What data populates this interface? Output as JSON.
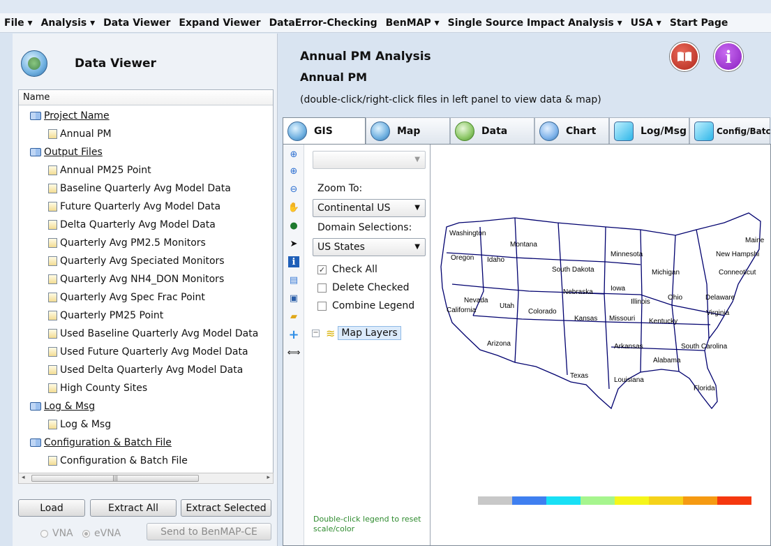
{
  "menu": [
    "File ▾",
    "Analysis ▾",
    "Data Viewer",
    "Expand Viewer",
    "DataError-Checking",
    "BenMAP ▾",
    "Single Source Impact Analysis ▾",
    "USA ▾",
    "Start Page"
  ],
  "left": {
    "title": "Data Viewer",
    "tree_header": "Name",
    "tree": [
      {
        "label": "Project Name",
        "type": "folder",
        "children": [
          "Annual PM"
        ]
      },
      {
        "label": "Output Files",
        "type": "folder",
        "children": [
          "Annual PM25 Point",
          "Baseline Quarterly Avg Model Data",
          "Future Quarterly Avg Model Data",
          "Delta Quarterly Avg Model Data",
          "Quarterly Avg PM2.5 Monitors",
          "Quarterly Avg Speciated Monitors",
          "Quarterly Avg NH4_DON Monitors",
          "Quarterly Avg Spec Frac Point",
          "Quarterly PM25 Point",
          "Used Baseline Quarterly Avg Model Data",
          "Used Future Quarterly Avg Model Data",
          "Used Delta Quarterly Avg Model Data",
          "High County Sites"
        ]
      },
      {
        "label": "Log & Msg",
        "type": "folder",
        "children": [
          "Log & Msg"
        ]
      },
      {
        "label": "Configuration & Batch File",
        "type": "folder",
        "children": [
          "Configuration & Batch File"
        ]
      }
    ],
    "buttons": {
      "load": "Load",
      "extract_all": "Extract All",
      "extract_selected": "Extract Selected",
      "send": "Send to BenMAP-CE"
    },
    "radios": {
      "vna": "VNA",
      "evna": "eVNA"
    }
  },
  "header": {
    "title": "Annual PM Analysis",
    "subtitle": "Annual PM",
    "hint": "(double-click/right-click files in left panel to view data & map)"
  },
  "tabs": [
    {
      "label": "GIS",
      "active": true
    },
    {
      "label": "Map",
      "active": false
    },
    {
      "label": "Data",
      "active": false
    },
    {
      "label": "Chart",
      "active": false
    },
    {
      "label": "Log/Msg",
      "active": false
    },
    {
      "label": "Config/Batch",
      "active": false
    }
  ],
  "gis": {
    "top_select_value": "",
    "zoom_label": "Zoom To:",
    "zoom_value": "Continental US",
    "domain_label": "Domain Selections:",
    "domain_value": "US States",
    "check_all": "Check All",
    "delete_checked": "Delete Checked",
    "combine_legend": "Combine Legend",
    "map_layers": "Map Layers",
    "legend_note": "Double-click legend to reset scale/color"
  },
  "map_labels": [
    "Washington",
    "Montana",
    "Minnesota",
    "Maine",
    "Oregon",
    "Idaho",
    "South Dakota",
    "Michigan",
    "New Hampshi",
    "Conneoticut",
    "Iowa",
    "Nebraska",
    "Nevada",
    "Utah",
    "Colorado",
    "Illinois",
    "Ohio",
    "Delaware",
    "California",
    "Kansas",
    "Missouri",
    "Kentucky",
    "Virginia",
    "Arizona",
    "Arkansas",
    "South Carolina",
    "Alabama",
    "Texas",
    "Louisiana",
    "Florida"
  ],
  "colors": {
    "legend": [
      "#c8c8c8",
      "#3f7ff0",
      "#19e0f5",
      "#a6f58e",
      "#f5f51a",
      "#f5d21a",
      "#f59a12",
      "#f5380f"
    ],
    "state_border": "#00006e",
    "book_button": "#c0392b",
    "info_button": "#9b26c9"
  }
}
